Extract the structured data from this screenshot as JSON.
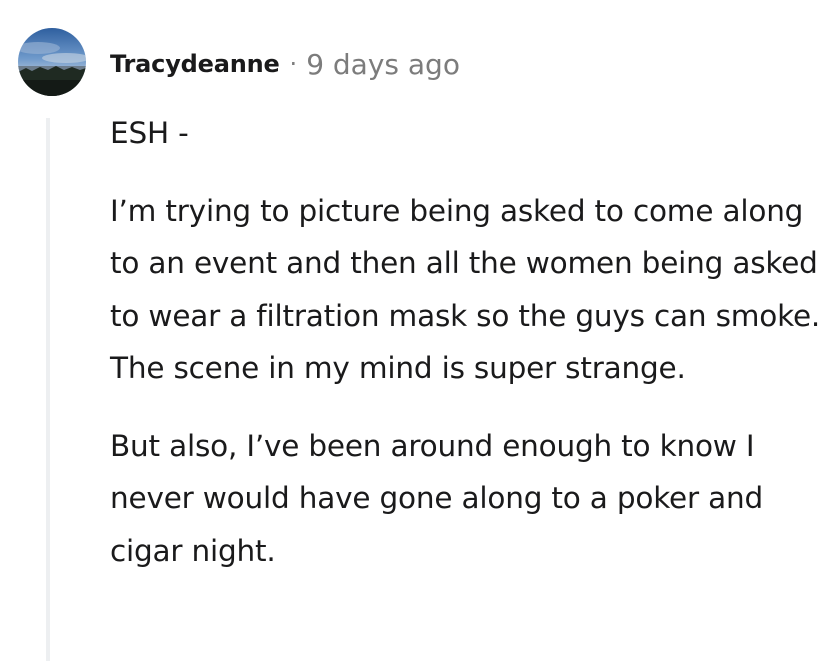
{
  "comment": {
    "author": "Tracydeanne",
    "separator": "·",
    "timestamp": "9 days ago",
    "avatar_icon": "landscape-avatar-icon",
    "paragraphs": [
      "ESH -",
      "I’m trying to picture being asked to come along to an event and then all the women being asked to wear a filtration mask so the guys can smoke. The scene in my mind is super strange.",
      "But also, I’ve been around enough to know I never would have gone along to a poker and cigar night."
    ]
  }
}
